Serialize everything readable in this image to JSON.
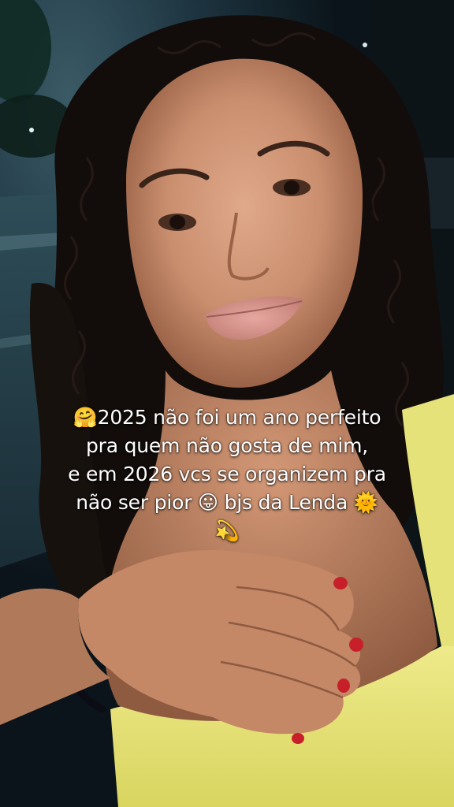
{
  "story": {
    "caption": {
      "line1": "🤗2025 não foi um ano perfeito",
      "line2": "pra quem não gosta de mim,",
      "line3": "e em 2026 vcs se organizem pra",
      "line4": "não ser pior 😛 bjs da Lenda 🌞",
      "line5": "💫"
    }
  },
  "colors": {
    "background": "#0e1a22",
    "hair": "#120d0b",
    "skin": "#c98e6e",
    "tank_top": "#e8e47a",
    "nail_polish": "#c8202a",
    "text": "#ffffff"
  }
}
